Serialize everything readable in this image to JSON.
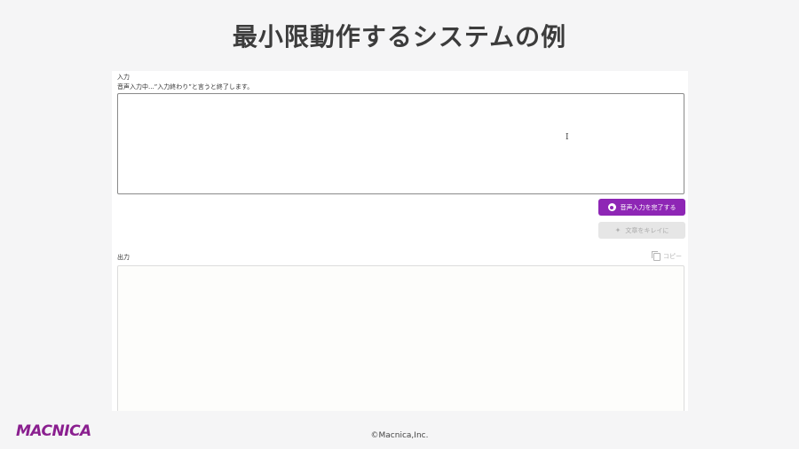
{
  "slide": {
    "title": "最小限動作するシステムの例",
    "copyright": "©Macnica,Inc.",
    "logo_text": "MACNICA"
  },
  "input": {
    "label": "入力",
    "status": "音声入力中...”入力終わり”と言うと終了します。",
    "value": ""
  },
  "buttons": {
    "finish_voice_label": "音声入力を完了する",
    "cleanup_label": "文章をキレイに"
  },
  "output": {
    "label": "出力",
    "copy_label": "コピー",
    "value": ""
  },
  "colors": {
    "accent": "#8e26b5",
    "disabled_bg": "#e6e6e6",
    "logo": "#8a1f8f"
  },
  "icons": {
    "record": "record-icon",
    "sparkle": "sparkle-icon",
    "copy": "copy-icon",
    "text_cursor": "text-cursor-icon"
  }
}
